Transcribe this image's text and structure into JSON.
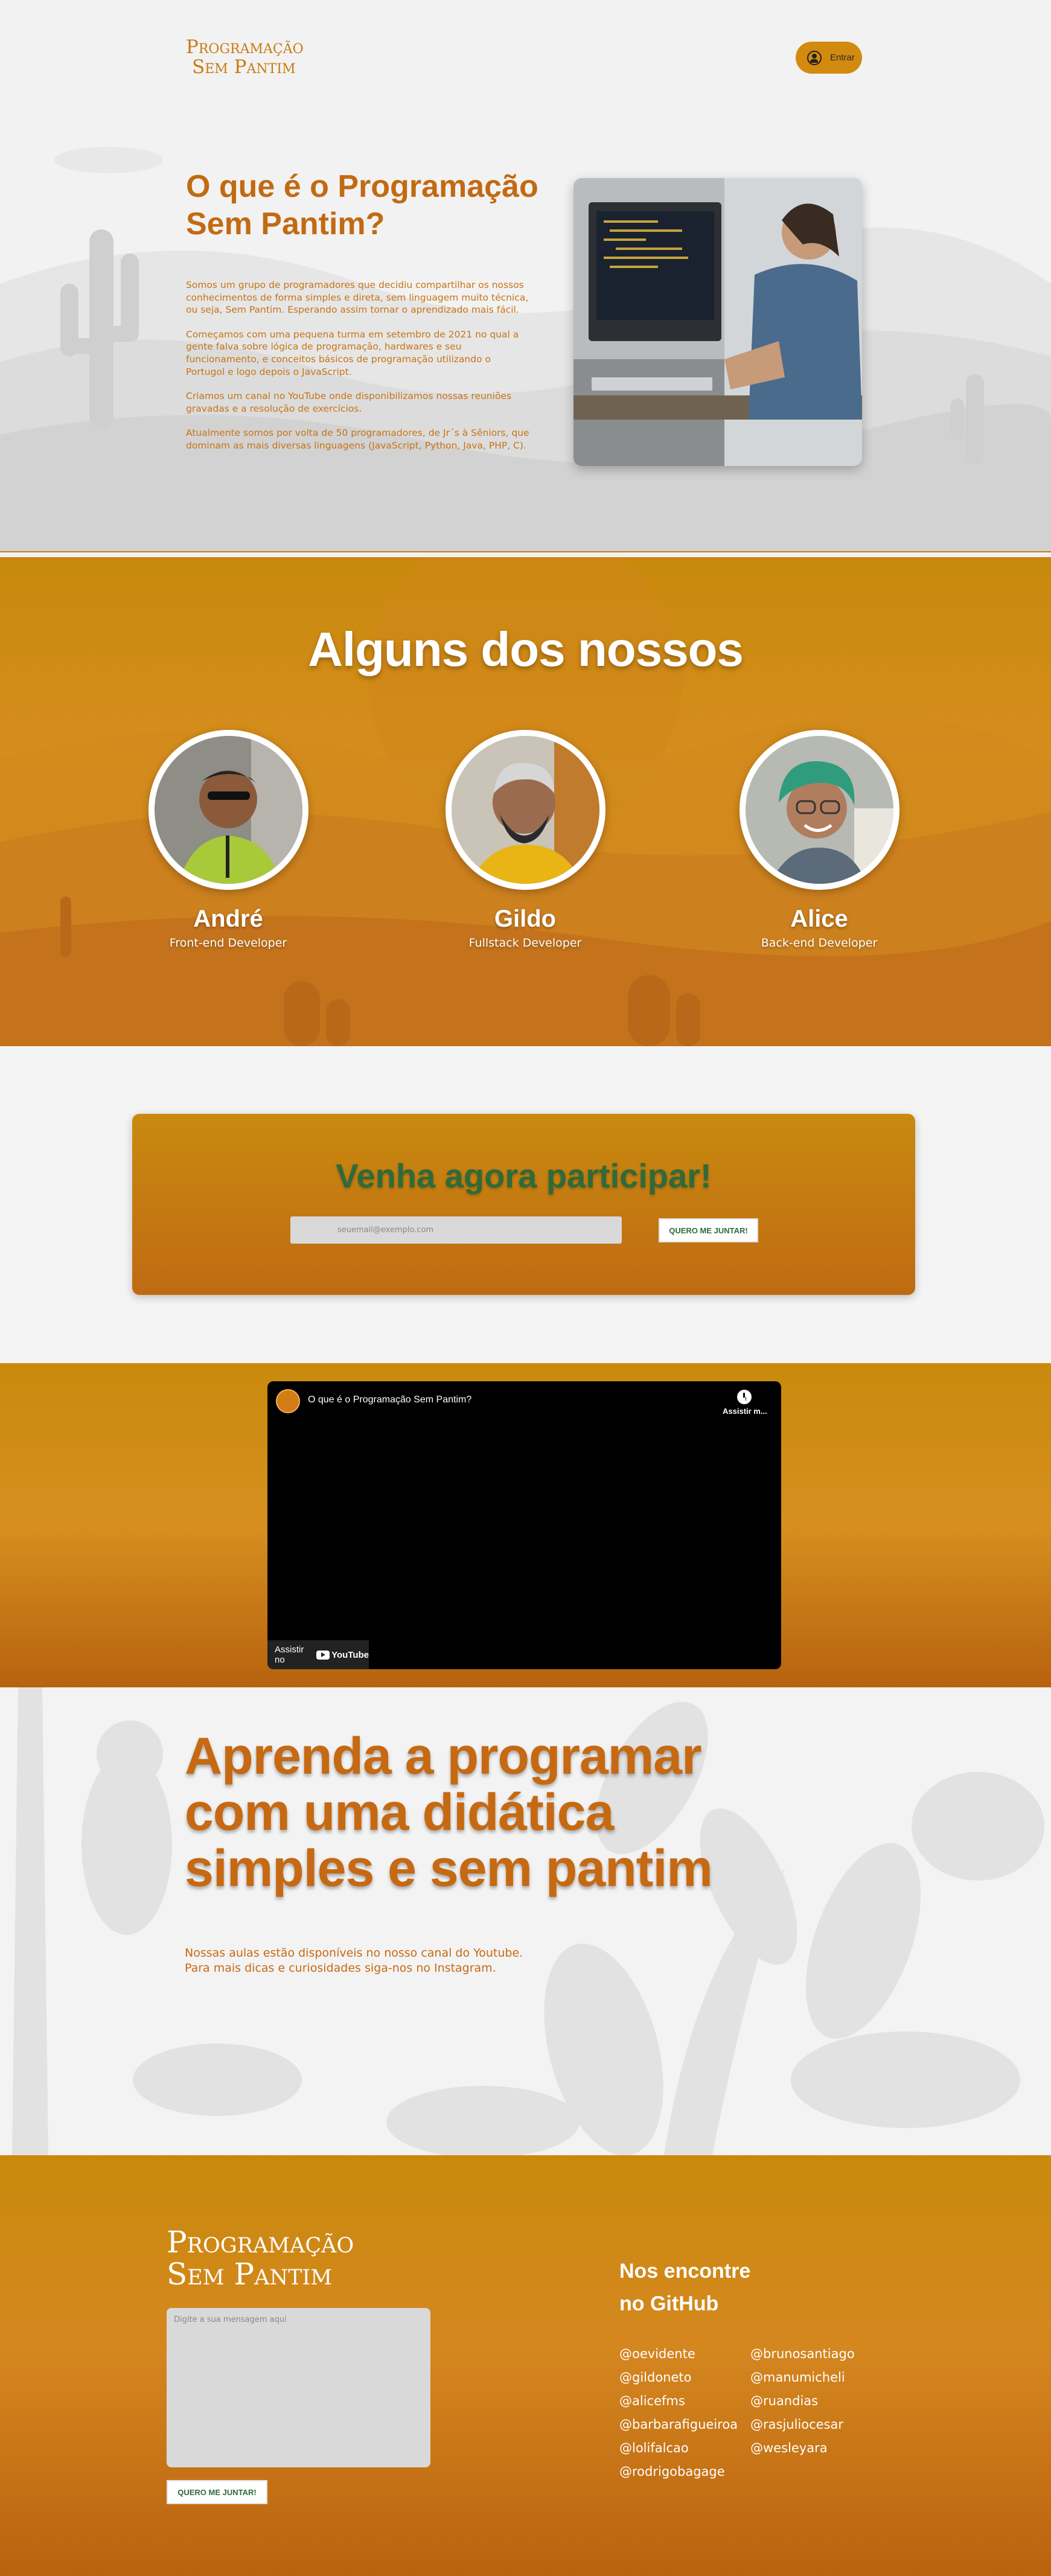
{
  "brand": {
    "line1": "Programação",
    "line2": "Sem Pantim"
  },
  "header": {
    "login_label": "Entrar"
  },
  "hero": {
    "title": "O que é o Programação Sem Pantim?",
    "paragraphs": [
      "Somos um grupo de programadores que decidiu compartilhar os nossos conhecimentos de forma simples e direta, sem linguagem muito técnica, ou seja, Sem Pantim. Esperando assim tornar o aprendizado mais fácil.",
      "Começamos com uma pequena turma em setembro de 2021 no qual a gente falva sobre lógica de programação, hardwares e seu funcionamento, e conceitos básicos de programação utilizando o Portugol e logo depois o JavaScript.",
      "Criamos um canal no YouTube onde disponibilizamos nossas reuniões gravadas e a resolução de exercícios.",
      "Atualmente somos por volta de 50 programadores, de Jr´s à Sêniors, que dominam as mais diversas linguagens (JavaScript, Python, Java, PHP, C)."
    ]
  },
  "team": {
    "title": "Alguns dos nossos",
    "members": [
      {
        "name": "André",
        "role": "Front-end Developer"
      },
      {
        "name": "Gildo",
        "role": "Fullstack Developer"
      },
      {
        "name": "Alice",
        "role": "Back-end Developer"
      }
    ]
  },
  "join": {
    "title": "Venha agora participar!",
    "email_placeholder": "seuemail@exemplo.com",
    "button_label": "QUERO ME JUNTAR!"
  },
  "video": {
    "title": "O que é o Programação Sem Pantim?",
    "watch_later": "Assistir m...",
    "watch_on": "Assistir no",
    "yt_label": "YouTube"
  },
  "learn": {
    "title": "Aprenda a programar com uma didática simples e sem pantim",
    "line1": "Nossas aulas estão disponíveis no nosso canal do Youtube.",
    "line2": "Para mais dicas e curiosidades siga-nos no Instagram."
  },
  "footer": {
    "message_placeholder": "Digite a sua mensagem aqui",
    "button_label": "QUERO ME JUNTAR!",
    "github_title": "Nos encontre no GitHub",
    "github_col1": [
      "@oevidente",
      "@gildoneto",
      "@alicefms",
      "@barbarafigueiroa",
      "@lolifalcao",
      "@rodrigobagage"
    ],
    "github_col2": [
      "@brunosantiago",
      "@manumicheli",
      "@ruandias",
      "@rasjuliocesar",
      "@wesleyara"
    ]
  },
  "colors": {
    "accent": "#c8650f",
    "gold": "#c98a0c",
    "green": "#2f6a3a"
  }
}
